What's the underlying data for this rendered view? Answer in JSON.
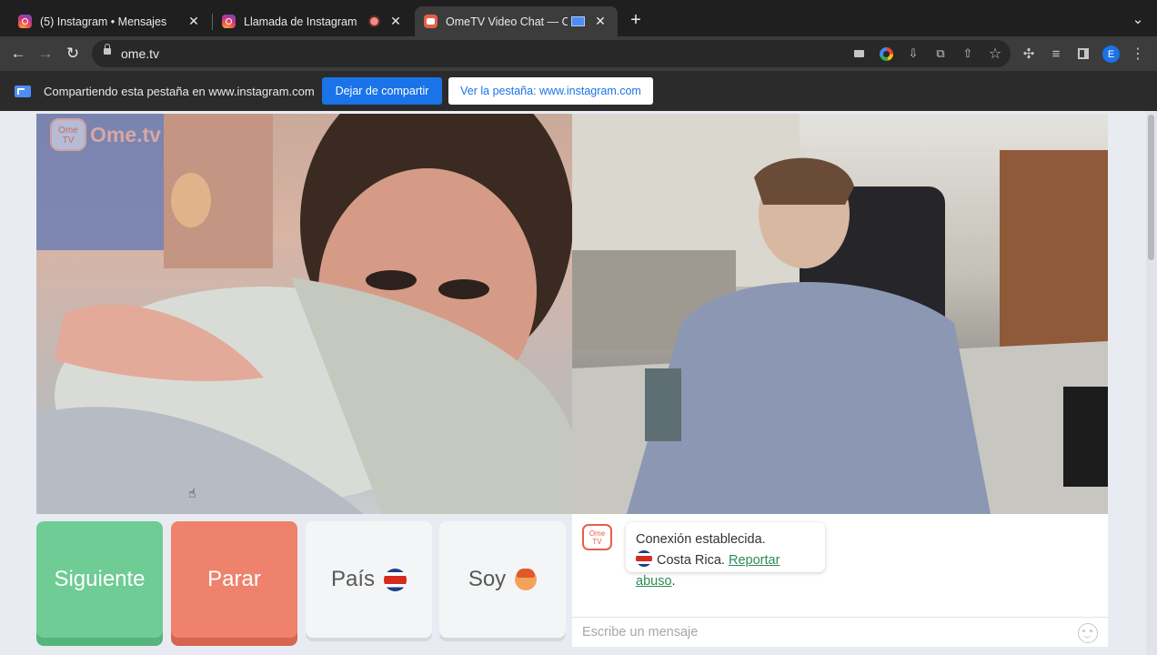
{
  "browser": {
    "tabs": [
      {
        "title": "(5) Instagram • Mensajes",
        "icon": "instagram-icon",
        "active": false
      },
      {
        "title": "Llamada de Instagram",
        "icon": "instagram-icon",
        "active": false
      },
      {
        "title": "OmeTV Video Chat — Ome",
        "icon": "ometv-icon",
        "active": true
      }
    ],
    "new_tab_icon": "+",
    "tab_menu_icon": "⌄",
    "url": "ome.tv",
    "profile_initial": "E"
  },
  "share_bar": {
    "message": "Compartiendo esta pestaña en www.instagram.com",
    "stop_label": "Dejar de compartir",
    "view_label": "Ver la pestaña: www.instagram.com"
  },
  "app": {
    "logo_badge": "Ome TV",
    "logo_word": "Ome.tv",
    "controls": {
      "next_label": "Siguiente",
      "stop_label": "Parar",
      "country_label": "País",
      "gender_label": "Soy"
    },
    "chat": {
      "status_line": "Conexión establecida.",
      "country": "Costa Rica.",
      "report_link": "Reportar abuso",
      "report_suffix": ".",
      "input_placeholder": "Escribe un mensaje",
      "badge": "Ome TV"
    }
  },
  "colors": {
    "next_button": "#6ecc94",
    "stop_button": "#ee826d",
    "share_primary": "#1a73e8",
    "report_link": "#2e8b57"
  }
}
